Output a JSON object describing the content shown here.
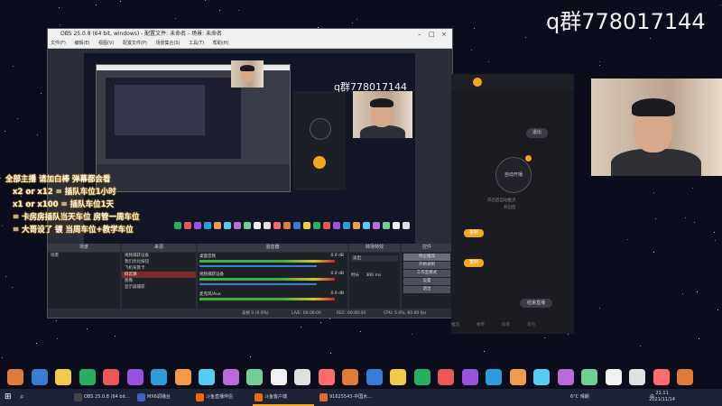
{
  "overlay": {
    "qq_group": "q群778017144"
  },
  "obs": {
    "title": "OBS 25.0.8 (64 bit, windows) - 配置文件: 未命名 - 场景: 未命名",
    "menu": [
      "文件(F)",
      "编辑(E)",
      "视图(V)",
      "配置文件(P)",
      "场景集合(S)",
      "工具(T)",
      "帮助(H)"
    ],
    "preview_qq": "q群778017144",
    "docks": {
      "scenes_header": "场景",
      "scenes": [
        "场景"
      ],
      "sources_header": "来源",
      "sources": [
        "视频捕获设备",
        "我们优化按钮",
        "飞机背景卡",
        "码云源",
        "图像",
        "显示器捕获"
      ],
      "mixer_header": "混音器",
      "mixer": [
        {
          "name": "桌面音频",
          "level": "0.0 dB"
        },
        {
          "name": "视频捕获设备",
          "level": "0.0 dB"
        },
        {
          "name": "麦克风/Aux",
          "level": "0.0 dB"
        }
      ],
      "transitions_header": "转场特效",
      "transition_type": "淡出",
      "duration_label": "时长",
      "duration_value": "300 ms",
      "controls_header": "控件",
      "controls": [
        "停止推流",
        "开始录制",
        "工作室模式",
        "设置",
        "退出"
      ]
    },
    "status": {
      "dropped": "丢帧 0 (0.0%)",
      "live": "LIVE: 00:00:00",
      "rec": "REC: 00:00:00",
      "cpu": "CPU: 5.0%, 60.00 fps"
    }
  },
  "danmu": [
    "全部主播 请加白棒 弹幕都会看",
    "x2 or x12 = 插队车位1小时",
    "x1 or x100 = 插队车位1天",
    "= 卡房房插队当天车位 房管一周车位",
    "= 大哥设了 镀 当周车位+教学车位"
  ],
  "right_app": {
    "exit_button": "退出",
    "auto_label": "自动开播",
    "caption1": "开启后自动推流",
    "caption2": "开启后",
    "action_buttons": [
      "复制",
      "复制"
    ],
    "bottom_button": "结束直播",
    "stats": [
      "推流",
      "帧率",
      "码率",
      "丢包"
    ]
  },
  "taskbar": {
    "items": [
      {
        "label": "OBS 25.0.8 (64 bit...",
        "color": "#444"
      },
      {
        "label": "MX6调播台",
        "color": "#3a62c9"
      },
      {
        "label": "斗鱼直播伴侣",
        "color": "#f56a00"
      },
      {
        "label": "斗鱼客户端",
        "color": "#f56a00"
      },
      {
        "label": "91625543-中国水...",
        "color": "#e06b2d"
      }
    ],
    "weather": "6°C 晴朗",
    "time": "21:11",
    "date": "2021/11/14",
    "ime": "中"
  },
  "colors": {
    "accent": "#f5a623",
    "live_red": "#c02b2b"
  }
}
